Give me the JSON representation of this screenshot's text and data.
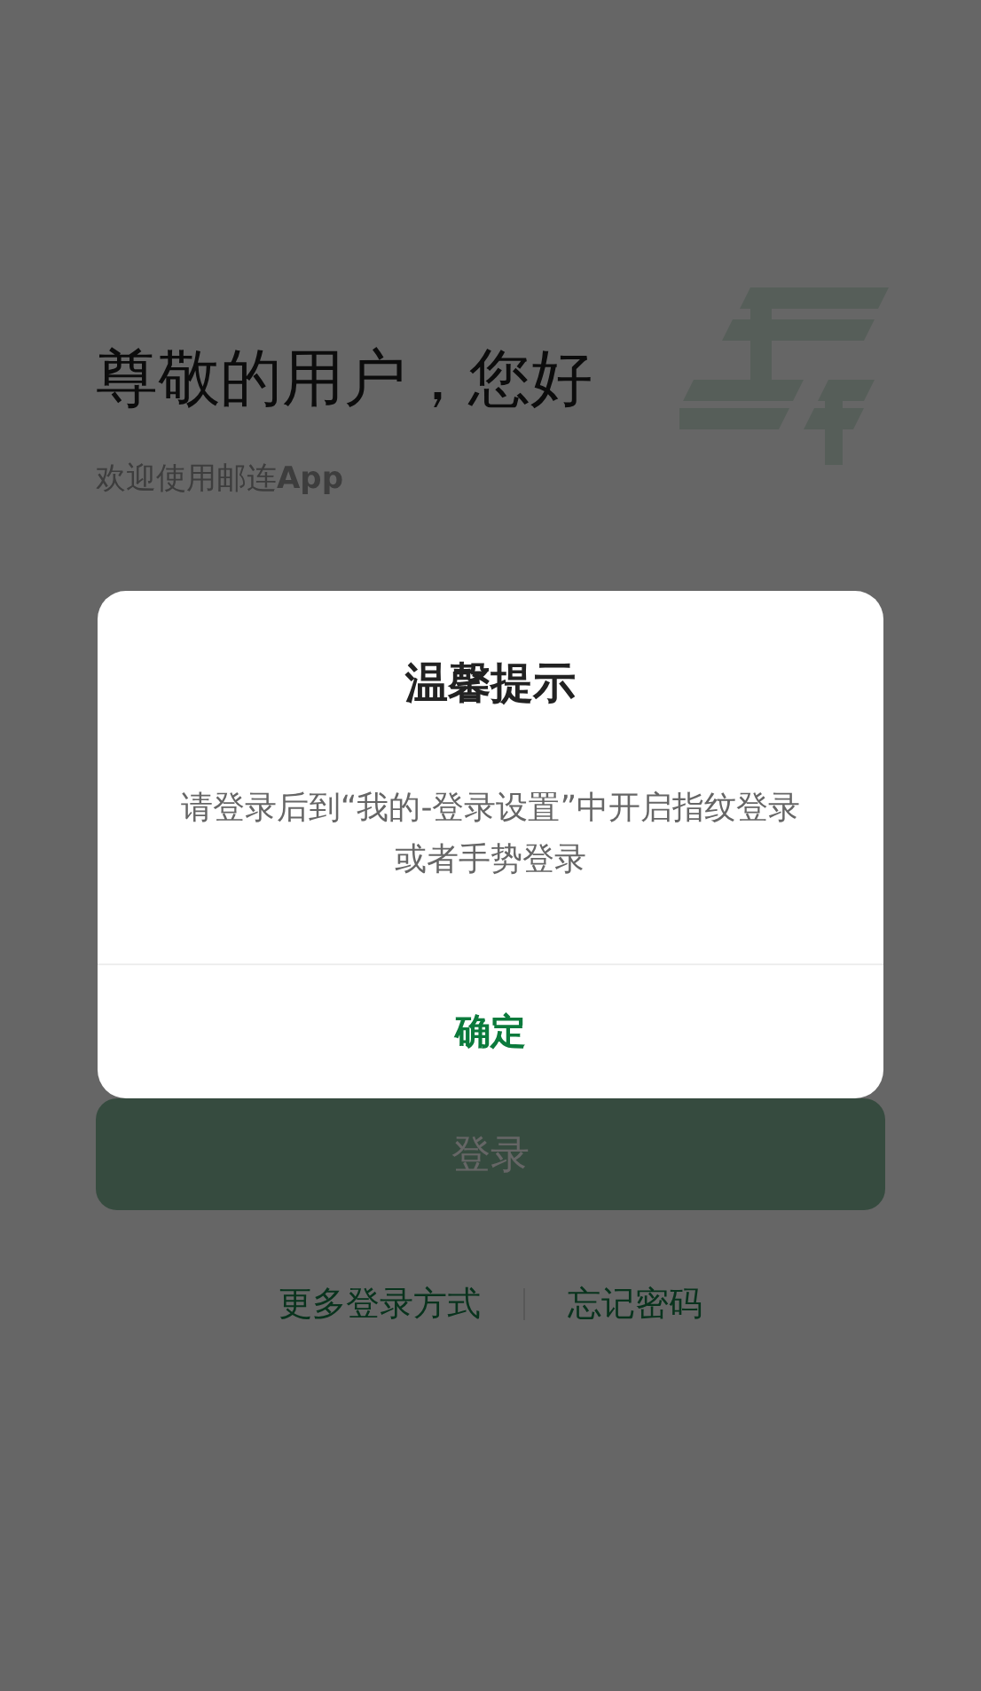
{
  "page": {
    "title": "尊敬的用户，您好",
    "subtitle": "欢迎使用邮连**App**",
    "login_button": "登录",
    "links": [
      "更多登录方式",
      "忘记密码"
    ]
  },
  "dialog": {
    "title": "温馨提示",
    "message": "请登录后到“我的-登录设置”中开启指纹登录或者手势登录",
    "button": "确定"
  }
}
